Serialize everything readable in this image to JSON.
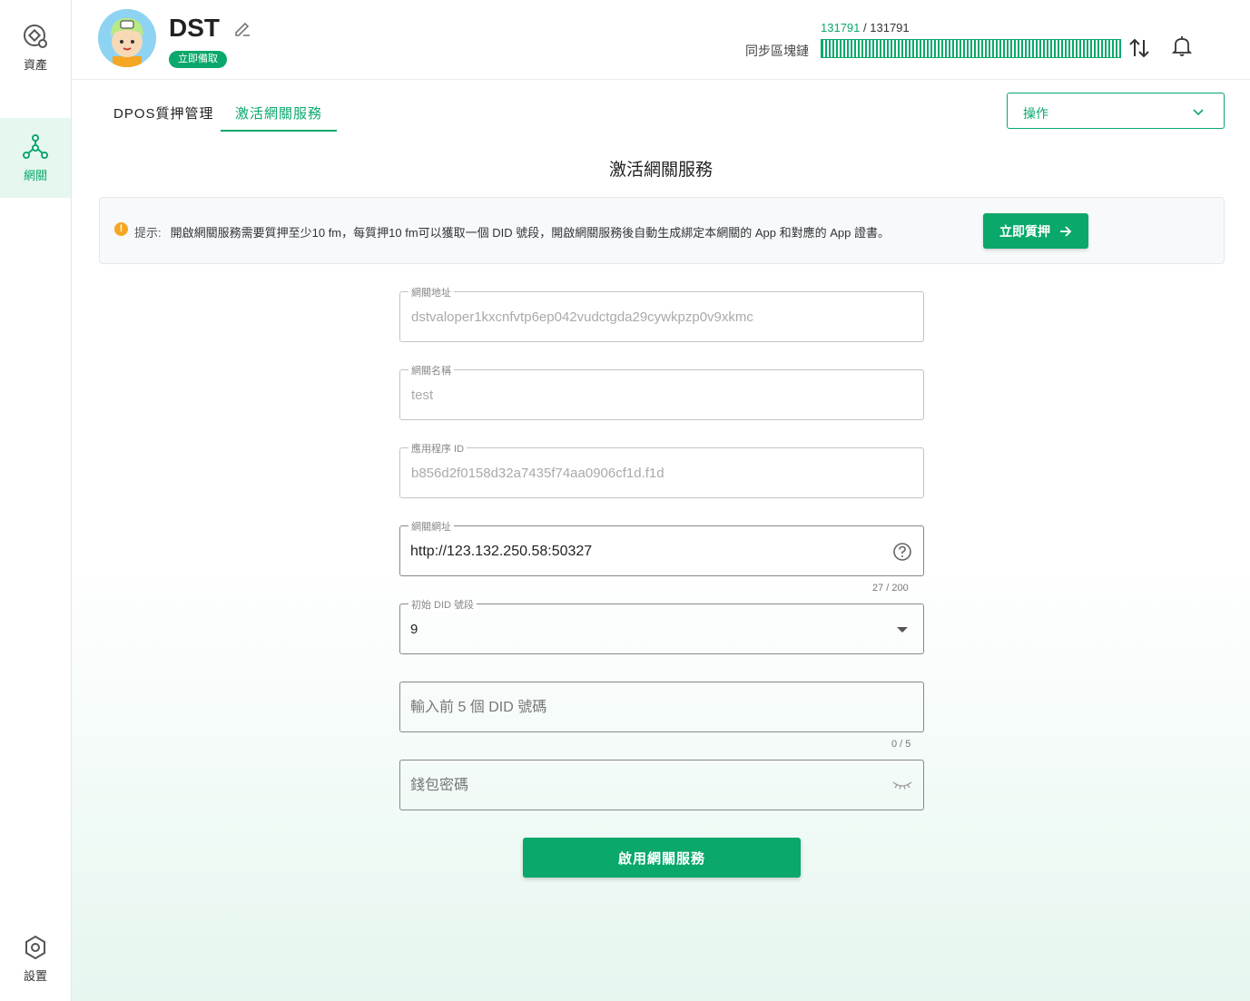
{
  "sidebar": {
    "items": [
      {
        "label": "資產",
        "icon": "assets-icon"
      },
      {
        "label": "網關",
        "icon": "gateway-icon",
        "active": true
      },
      {
        "label": "設置",
        "icon": "settings-icon"
      }
    ]
  },
  "header": {
    "account_name": "DST",
    "backup_badge": "立即備取",
    "sync": {
      "current": "131791",
      "separator": "/",
      "total": "131791",
      "label": "同步區塊鏈",
      "progress": 1.0
    }
  },
  "tabs": [
    {
      "label": "DPOS質押管理",
      "active": false
    },
    {
      "label": "激活網關服務",
      "active": true
    }
  ],
  "operations_select": {
    "label": "操作"
  },
  "page_title": "激活網關服務",
  "hint": {
    "prefix": "提示:",
    "text": "開啟網關服務需要質押至少10 fm，每質押10 fm可以獲取一個 DID 號段，開啟網關服務後自動生成綁定本網關的 App 和對應的 App 證書。",
    "button": "立即質押"
  },
  "form": {
    "gateway_address": {
      "label": "網關地址",
      "value": "dstvaloper1kxcnfvtp6ep042vudctgda29cywkpzp0v9xkmc"
    },
    "gateway_name": {
      "label": "網關名稱",
      "value": "test"
    },
    "app_id": {
      "label": "應用程序 ID",
      "value": "b856d2f0158d32a7435f74aa0906cf1d.f1d"
    },
    "gateway_url": {
      "label": "網關網址",
      "value": "http://123.132.250.58:50327",
      "counter": "27 / 200"
    },
    "did_segment": {
      "label": "初始 DID 號段",
      "value": "9"
    },
    "did_prefix": {
      "placeholder": "輸入前 5 個 DID 號碼",
      "counter": "0 / 5"
    },
    "wallet_password": {
      "placeholder": "錢包密碼"
    },
    "submit": "啟用網關服務"
  },
  "colors": {
    "accent": "#0aa86b",
    "warning": "#f5a623"
  }
}
